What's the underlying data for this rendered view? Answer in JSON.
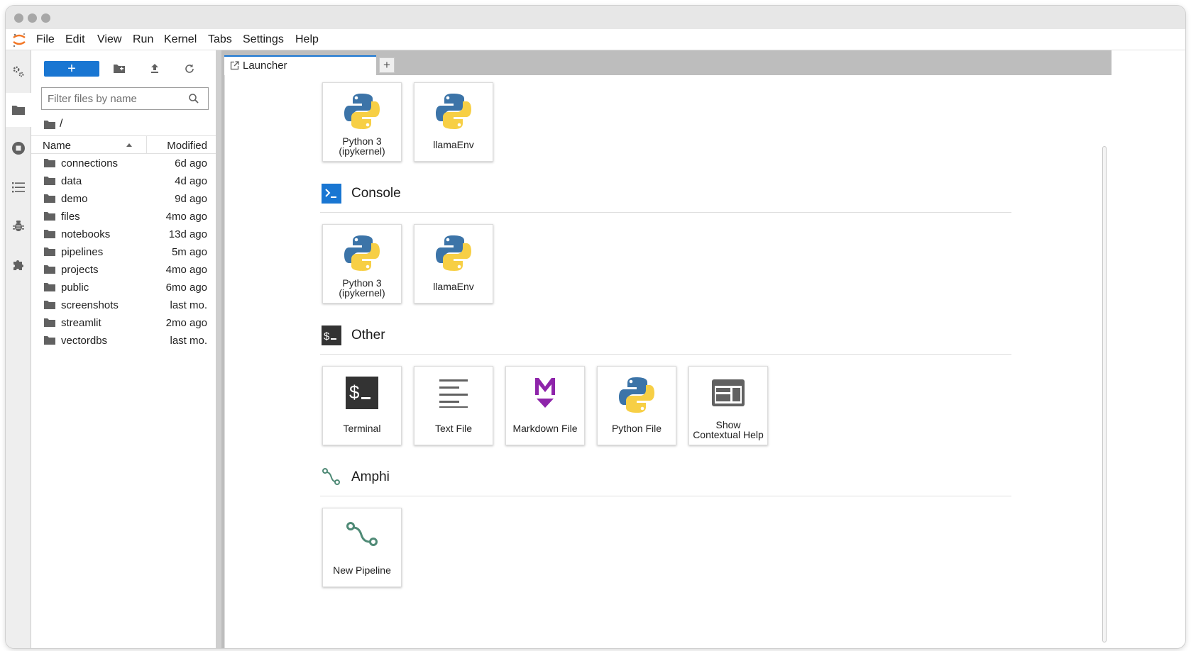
{
  "menubar": {
    "items": [
      "File",
      "Edit",
      "View",
      "Run",
      "Kernel",
      "Tabs",
      "Settings",
      "Help"
    ]
  },
  "activity_bar": {
    "icons": [
      "property-inspector-icon",
      "folder-icon",
      "running-icon",
      "toc-icon",
      "debugger-icon",
      "extension-icon"
    ]
  },
  "file_browser": {
    "new_button": "+",
    "filter_placeholder": "Filter files by name",
    "breadcrumb": "/",
    "columns": {
      "name": "Name",
      "modified": "Modified"
    },
    "files": [
      {
        "name": "connections",
        "modified": "6d ago"
      },
      {
        "name": "data",
        "modified": "4d ago"
      },
      {
        "name": "demo",
        "modified": "9d ago"
      },
      {
        "name": "files",
        "modified": "4mo ago"
      },
      {
        "name": "notebooks",
        "modified": "13d ago"
      },
      {
        "name": "pipelines",
        "modified": "5m ago"
      },
      {
        "name": "projects",
        "modified": "4mo ago"
      },
      {
        "name": "public",
        "modified": "6mo ago"
      },
      {
        "name": "screenshots",
        "modified": "last mo."
      },
      {
        "name": "streamlit",
        "modified": "2mo ago"
      },
      {
        "name": "vectordbs",
        "modified": "last mo."
      }
    ]
  },
  "tabs": {
    "active_label": "Launcher",
    "add_label": "+"
  },
  "launcher": {
    "notebook_cards": [
      {
        "line1": "Python 3",
        "line2": "(ipykernel)"
      },
      {
        "line1": "llamaEnv",
        "line2": ""
      }
    ],
    "console": {
      "title": "Console",
      "cards": [
        {
          "line1": "Python 3",
          "line2": "(ipykernel)"
        },
        {
          "line1": "llamaEnv",
          "line2": ""
        }
      ]
    },
    "other": {
      "title": "Other",
      "cards": [
        {
          "line1": "Terminal",
          "line2": ""
        },
        {
          "line1": "Text File",
          "line2": ""
        },
        {
          "line1": "Markdown File",
          "line2": ""
        },
        {
          "line1": "Python File",
          "line2": ""
        },
        {
          "line1": "Show",
          "line2": "Contextual Help"
        }
      ]
    },
    "amphi": {
      "title": "Amphi",
      "cards": [
        {
          "line1": "New Pipeline",
          "line2": ""
        }
      ]
    }
  },
  "colors": {
    "accent": "#1976d2",
    "markdown": "#8e24aa",
    "amphi": "#4f8a76",
    "python_blue": "#3c74a8",
    "python_yellow": "#f7cf45"
  }
}
